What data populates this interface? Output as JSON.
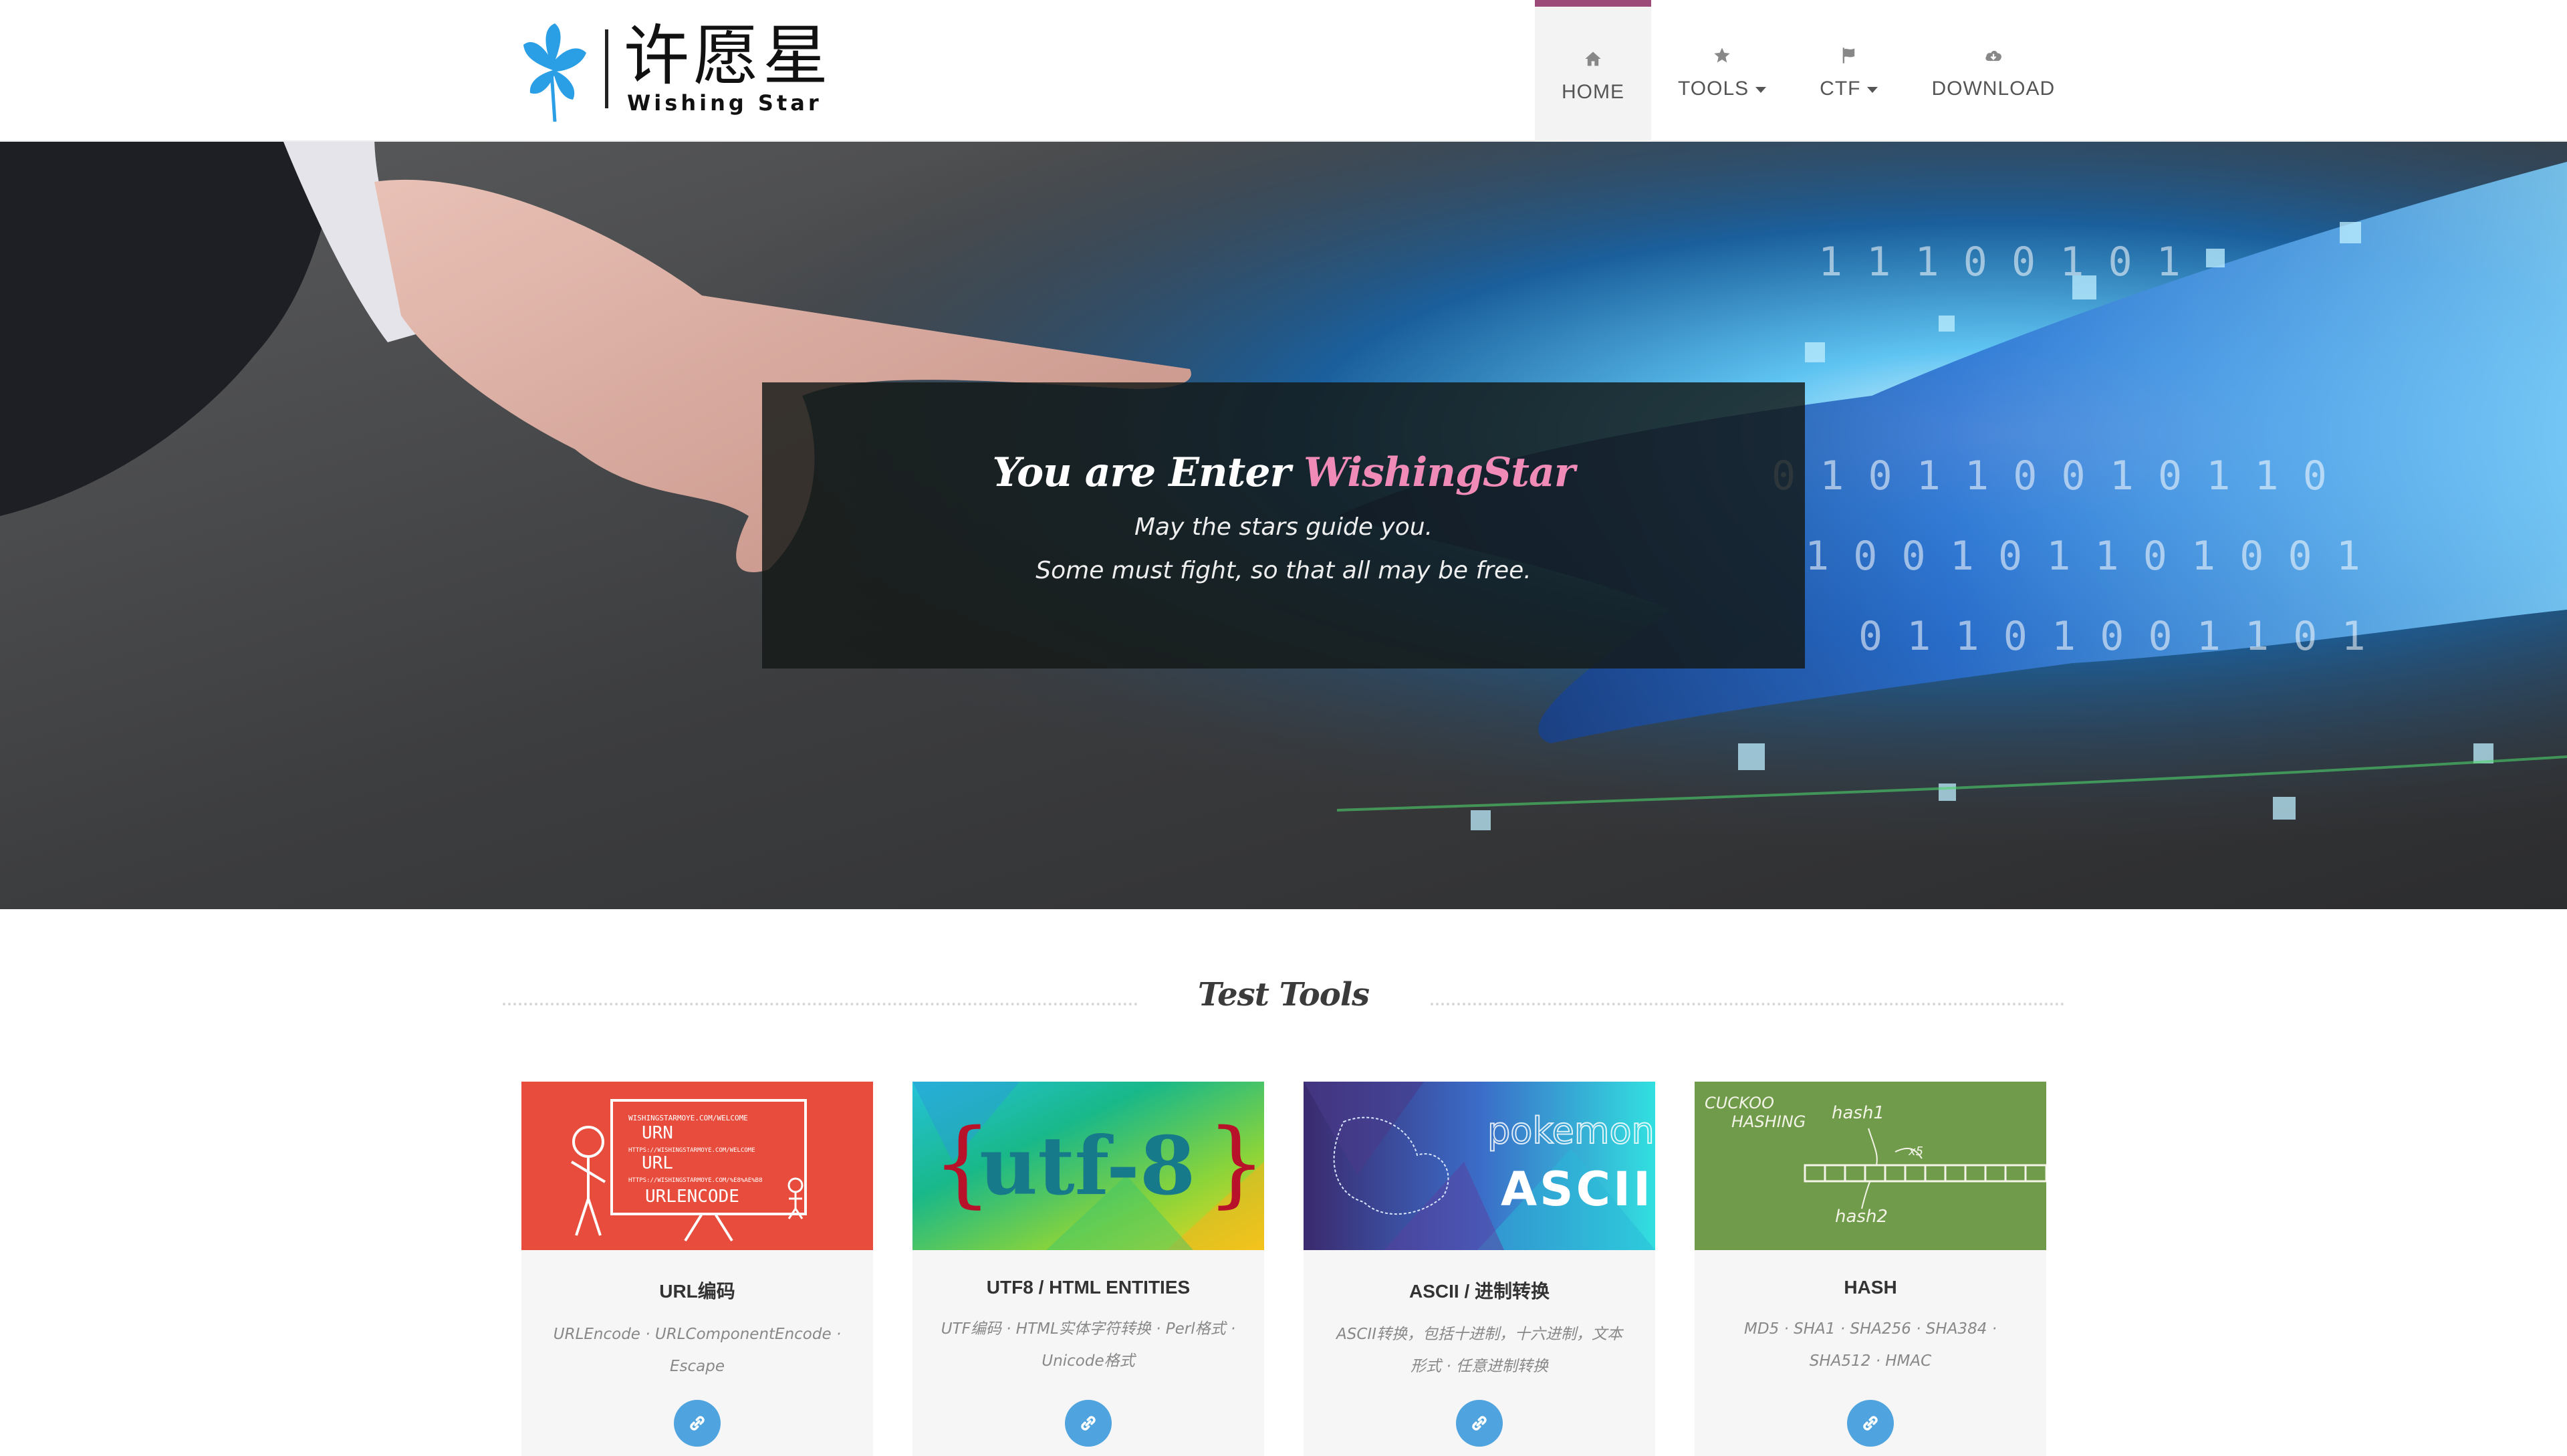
{
  "brand": {
    "name_cn": "许愿星",
    "name_en": "Wishing Star",
    "colors": {
      "flower": "#2a9fe6",
      "text": "#111111"
    }
  },
  "nav": {
    "items": [
      {
        "label": "HOME",
        "icon": "home-icon",
        "active": true
      },
      {
        "label": "TOOLS",
        "icon": "star-icon",
        "dropdown": true
      },
      {
        "label": "CTF",
        "icon": "flag-icon",
        "dropdown": true
      },
      {
        "label": "DOWNLOAD",
        "icon": "cloud-download-icon"
      }
    ],
    "active_color": "#9c4a77"
  },
  "hero": {
    "title_prefix": "You are Enter",
    "title_accent": "WishingStar",
    "line1": "May the stars guide you.",
    "line2": "Some must fight, so that all may be free.",
    "accent_color": "#f08ab6"
  },
  "section": {
    "title": "Test Tools"
  },
  "cards": [
    {
      "title": "URL编码",
      "desc": "URLEncode · URLComponentEncode · Escape",
      "image": {
        "bg": "#e74c3c",
        "lines": [
          "WISHINGSTARMOYE.COM/WELCOME",
          "URN",
          "HTTPS://WISHINGSTARMOYE.COM/WELCOME",
          "URL",
          "HTTPS://WISHINGSTARMOYE.COM/%E8%AE%B8",
          "URLENCODE"
        ]
      }
    },
    {
      "title": "UTF8 / HTML ENTITIES",
      "desc": "UTF编码 · HTML实体字符转换 · Perl格式 · Unicode格式",
      "image": {
        "text_open": "{",
        "text_main": "utf-8",
        "text_close": "}"
      }
    },
    {
      "title": "ASCII / 进制转换",
      "desc": "ASCII转换，包括十进制，十六进制，文本形式 · 任意进制转换",
      "image": {
        "label_top": "pokemon",
        "label_main": "ASCII"
      }
    },
    {
      "title": "HASH",
      "desc": "MD5 · SHA1 · SHA256 · SHA384 · SHA512 · HMAC",
      "image": {
        "bg": "#6f9b4a",
        "label1": "CUCKOO",
        "label2": "HASHING",
        "label3": "hash1",
        "label4": "hash2",
        "label5": "x5"
      }
    }
  ]
}
